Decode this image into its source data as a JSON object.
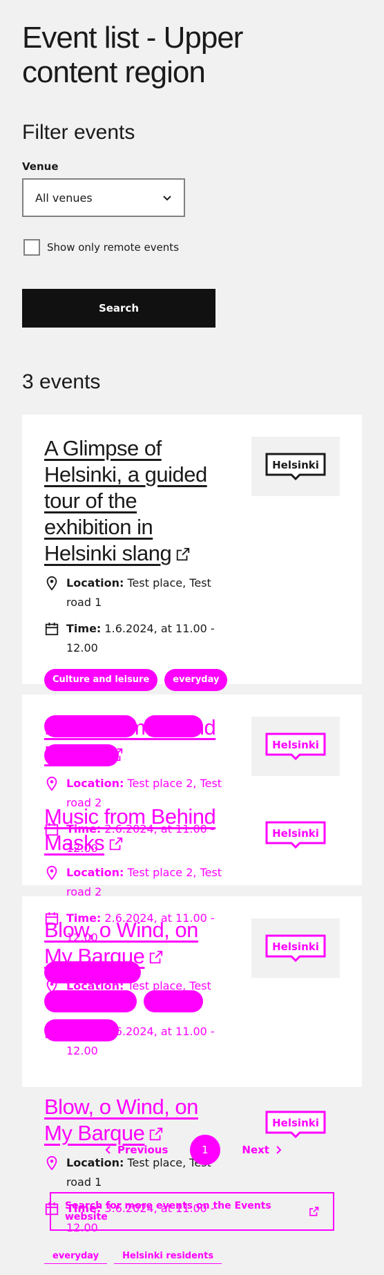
{
  "page": {
    "title": "Event list - Upper content region",
    "filter_heading": "Filter events",
    "venue_label": "Venue",
    "venue_value": "All venues",
    "remote_label": "Show only remote events",
    "search_label": "Search",
    "results_count": "3 events"
  },
  "labels": {
    "location": "Location:",
    "time": "Time:"
  },
  "logo_text": "Helsinki",
  "events": [
    {
      "title": "A Glimpse of Helsinki, a guided tour of the exhibition in Helsinki slang",
      "location": "Test place, Test road 1",
      "time": "1.6.2024, at 11.00 - 12.00",
      "tags": [
        "Culture and leisure",
        "everyday"
      ]
    },
    {
      "title": "Music from Behind Masks",
      "location": "Test place 2, Test road 2",
      "time": "2.6.2024, at 11.00 - 12.00"
    },
    {
      "title": "Music from Behind Masks",
      "location": "Test place 2, Test road 2",
      "time": "2.6.2024, at 11.00 - 12.00"
    },
    {
      "title": "Blow, o Wind, on My Barque",
      "location": "Test place, Test road 1",
      "time": "3.6.2024, at 11.00 - 12.00"
    },
    {
      "title": "Blow, o Wind, on My Barque",
      "location": "Test place, Test road 1",
      "time": "3.6.2024, at 11.00 - 12.00",
      "tags": [
        "everyday",
        "Helsinki residents"
      ]
    }
  ],
  "pagination": {
    "previous": "Previous",
    "current": "1",
    "next": "Next"
  },
  "more_link": "Search for more events on the Events website",
  "colors": {
    "background": "#f1f1f1",
    "accent": "#ff00ff",
    "button": "#111111"
  }
}
